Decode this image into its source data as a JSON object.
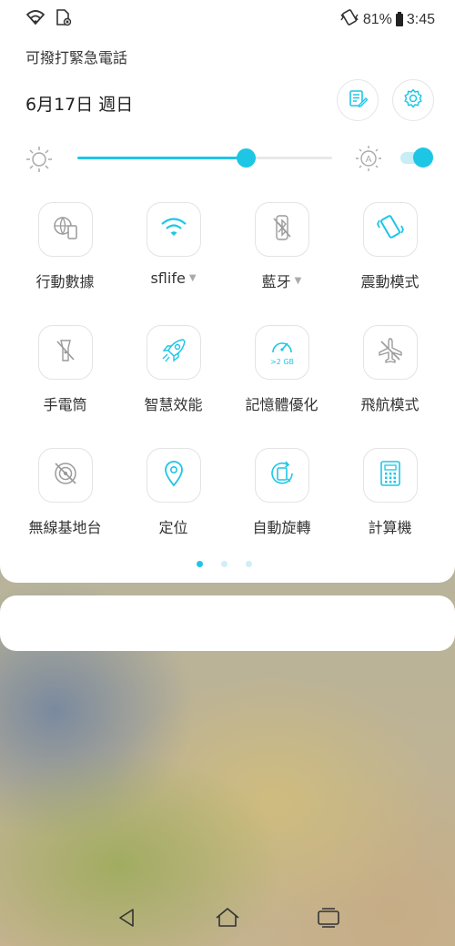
{
  "status_bar": {
    "battery_percent": "81%",
    "time": "3:45",
    "icons": [
      "wifi-icon",
      "sim-card-icon",
      "vibrate-icon",
      "battery-icon"
    ]
  },
  "header": {
    "emergency_text": "可撥打緊急電話",
    "date": "6月17日 週日",
    "buttons": [
      "edit-icon",
      "gear-icon"
    ]
  },
  "brightness": {
    "level": 0.66,
    "auto_enabled": true,
    "icons": [
      "sun-icon",
      "auto-brightness-icon"
    ]
  },
  "tiles": [
    {
      "label": "行動數據",
      "icon": "mobile-data-icon",
      "active": false,
      "caret": false
    },
    {
      "label": "sflife",
      "icon": "wifi-icon",
      "active": true,
      "caret": true
    },
    {
      "label": "藍牙",
      "icon": "bluetooth-off-icon",
      "active": false,
      "caret": true
    },
    {
      "label": "震動模式",
      "icon": "vibrate-mode-icon",
      "active": true,
      "caret": false
    },
    {
      "label": "手電筒",
      "icon": "flashlight-off-icon",
      "active": false,
      "caret": false
    },
    {
      "label": "智慧效能",
      "icon": "rocket-icon",
      "active": true,
      "caret": false
    },
    {
      "label": "記憶體優化",
      "icon": "memory-gauge-icon",
      "active": true,
      "caret": false,
      "badge": ">2 GB"
    },
    {
      "label": "飛航模式",
      "icon": "airplane-off-icon",
      "active": false,
      "caret": false
    },
    {
      "label": "無線基地台",
      "icon": "hotspot-off-icon",
      "active": false,
      "caret": false
    },
    {
      "label": "定位",
      "icon": "location-pin-icon",
      "active": true,
      "caret": false
    },
    {
      "label": "自動旋轉",
      "icon": "auto-rotate-icon",
      "active": true,
      "caret": false
    },
    {
      "label": "計算機",
      "icon": "calculator-icon",
      "active": true,
      "caret": false
    }
  ],
  "page_indicator": {
    "count": 3,
    "active": 0
  },
  "colors": {
    "accent": "#1ec6e6",
    "inactive": "#9a9a9a"
  },
  "navbar": [
    "back-icon",
    "home-icon",
    "recent-apps-icon"
  ]
}
